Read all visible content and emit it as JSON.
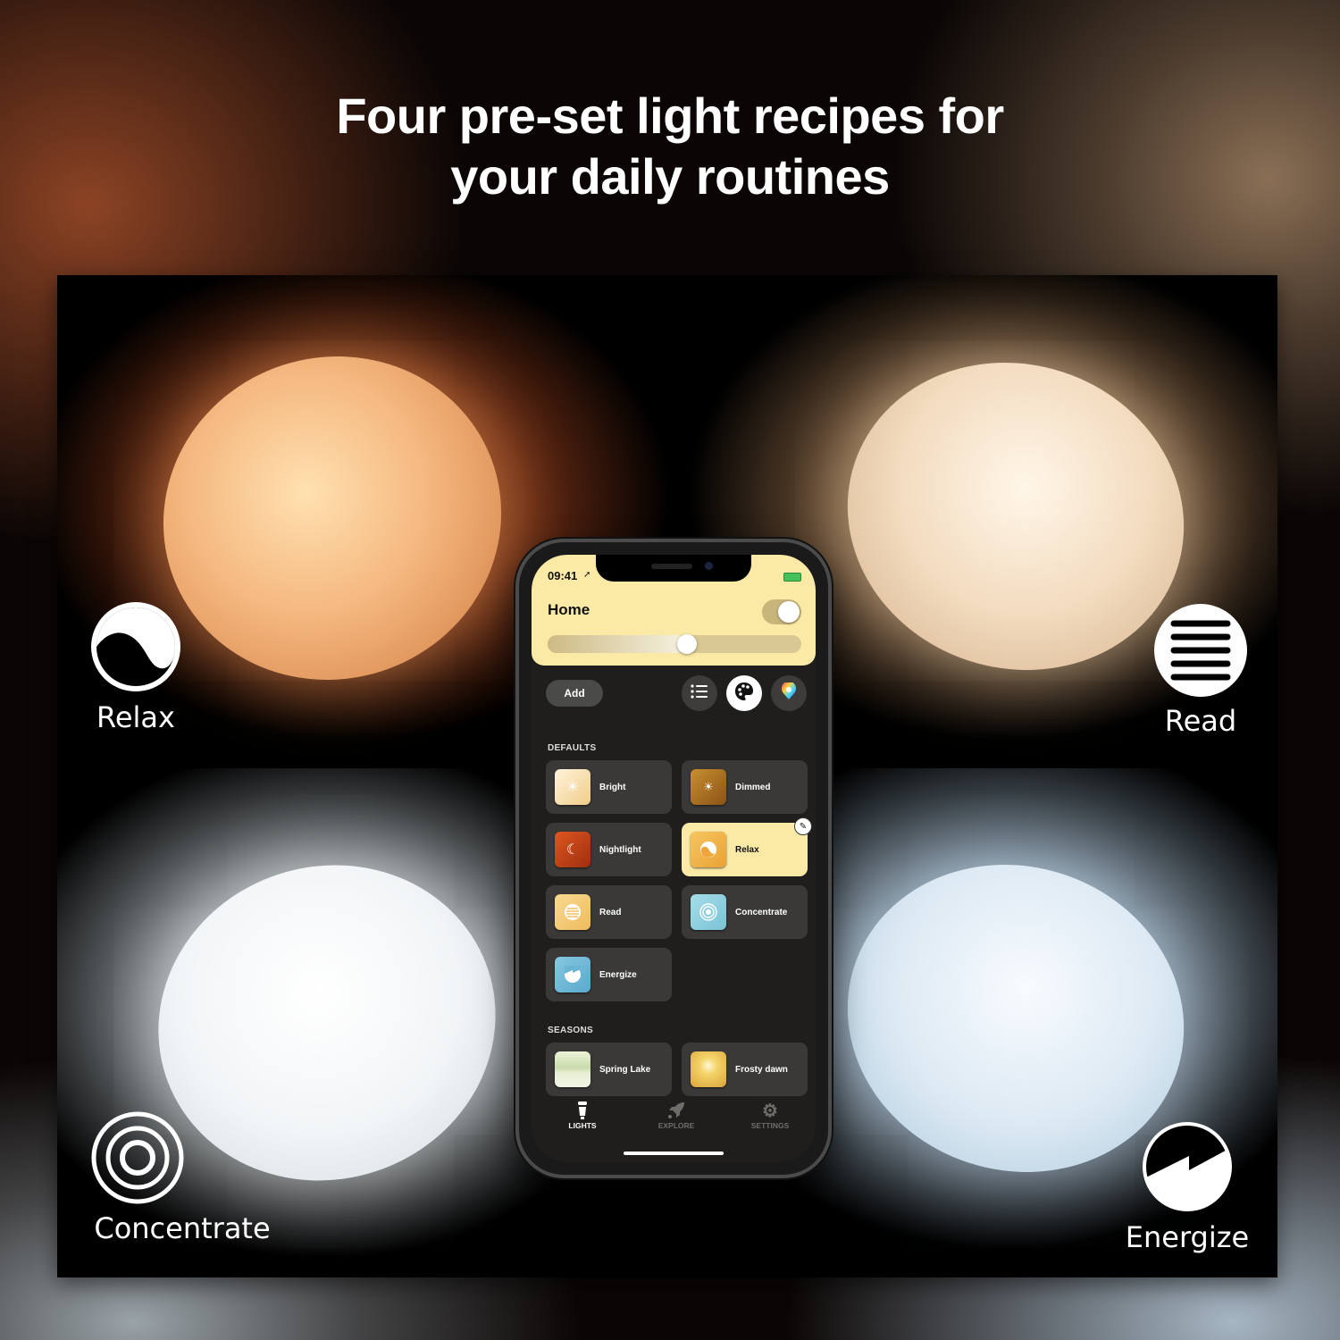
{
  "headline": {
    "line1": "Four pre-set light recipes for",
    "line2": "your daily routines"
  },
  "recipes": [
    {
      "id": "relax",
      "label": "Relax",
      "icon": "relax-yin-icon",
      "lamp_color": "#f5b880"
    },
    {
      "id": "read",
      "label": "Read",
      "icon": "read-lines-icon",
      "lamp_color": "#f3dcc0"
    },
    {
      "id": "concentrate",
      "label": "Concentrate",
      "icon": "concentric-circles-icon",
      "lamp_color": "#f2f5f7"
    },
    {
      "id": "energize",
      "label": "Energize",
      "icon": "energize-bolt-icon",
      "lamp_color": "#dce9f3"
    }
  ],
  "phone": {
    "status": {
      "time": "09:41",
      "location_icon": "location-arrow-icon",
      "battery_icon": "battery-charging-icon"
    },
    "header": {
      "title": "Home",
      "power_on": true,
      "brightness": 0.55,
      "accent": "#fbeaa6"
    },
    "toolbar": {
      "add_label": "Add",
      "buttons": [
        {
          "name": "list-view",
          "icon": "list-icon"
        },
        {
          "name": "scenes-view",
          "icon": "palette-icon",
          "selected": true
        },
        {
          "name": "color-picker",
          "icon": "color-wheel-icon"
        }
      ]
    },
    "sections": [
      {
        "title": "DEFAULTS",
        "tiles": [
          {
            "label": "Bright",
            "icon": "sun-icon",
            "color": "#f6dfae"
          },
          {
            "label": "Dimmed",
            "icon": "sun-dim-icon",
            "color": "#b67a2a"
          },
          {
            "label": "Nightlight",
            "icon": "moon-stars-icon",
            "color": "#c8441c"
          },
          {
            "label": "Relax",
            "icon": "relax-yin-icon",
            "color": "#f2b550",
            "active": true,
            "editable": true
          },
          {
            "label": "Read",
            "icon": "read-lines-icon",
            "color": "#f4cd7c"
          },
          {
            "label": "Concentrate",
            "icon": "concentric-circles-icon",
            "color": "#8fd0df"
          },
          {
            "label": "Energize",
            "icon": "energize-bolt-icon",
            "color": "#6fb8d6"
          }
        ]
      },
      {
        "title": "SEASONS",
        "tiles": [
          {
            "label": "Spring Lake",
            "icon": "spring-lake-thumbnail",
            "color": "#dfe8c4"
          },
          {
            "label": "Frosty dawn",
            "icon": "frosty-dawn-thumbnail",
            "color": "#eec24f"
          }
        ]
      }
    ],
    "tabbar": [
      {
        "label": "LIGHTS",
        "icon": "bulb-icon",
        "active": true
      },
      {
        "label": "EXPLORE",
        "icon": "rocket-icon",
        "active": false
      },
      {
        "label": "SETTINGS",
        "icon": "gear-icon",
        "active": false
      }
    ]
  }
}
